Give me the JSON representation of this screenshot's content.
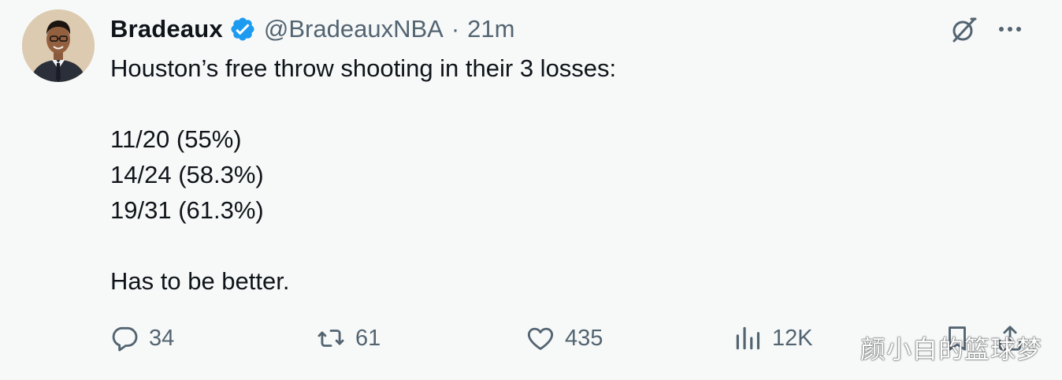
{
  "author": {
    "display_name": "Bradeaux",
    "handle": "@BradeauxNBA",
    "separator": "·",
    "time": "21m",
    "verified": true
  },
  "tweet": {
    "lines": [
      "Houston’s free throw shooting in their 3 losses:",
      "",
      "11/20 (55%)",
      "14/24 (58.3%)",
      "19/31 (61.3%)",
      "",
      "Has to be better."
    ]
  },
  "actions": {
    "replies": "34",
    "retweets": "61",
    "likes": "435",
    "views": "12K"
  },
  "icons": {
    "verified": "verified-badge-icon",
    "grok": "grok-icon",
    "more": "more-icon",
    "reply": "reply-icon",
    "retweet": "retweet-icon",
    "like": "heart-icon",
    "views": "views-icon",
    "bookmark": "bookmark-icon",
    "share": "share-icon"
  },
  "colors": {
    "background": "#f7f9f9",
    "text": "#0f1419",
    "muted": "#536471",
    "verified_blue": "#1d9bf0"
  },
  "watermark": "颜小白的篮球梦"
}
